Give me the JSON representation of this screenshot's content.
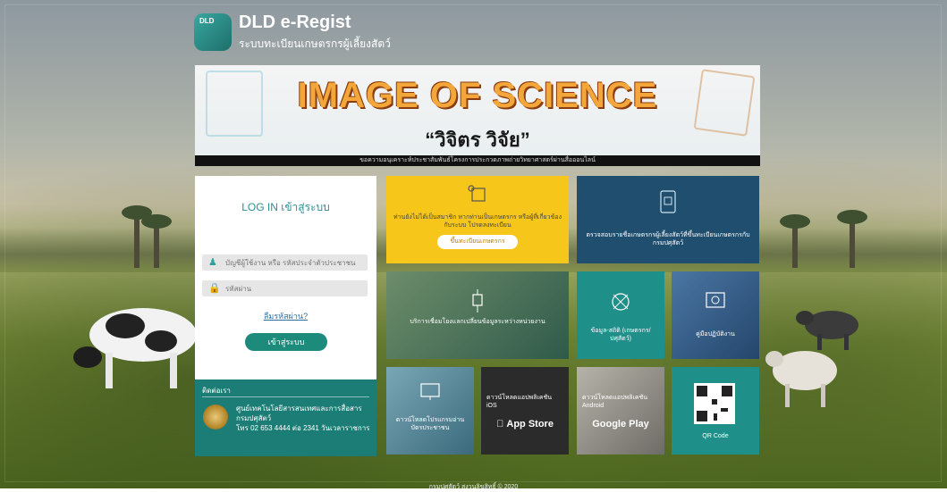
{
  "app": {
    "logo_text": "DLD",
    "title": "DLD e-Regist",
    "subtitle": "ระบบทะเบียนเกษตรกรผู้เลี้ยงสัตว์"
  },
  "banner": {
    "main": "IMAGE OF SCIENCE",
    "sub": "“วิจิตร วิจัย”",
    "caption": "ขอความอนุเคราะห์ประชาสัมพันธ์โครงการประกวดภาพถ่ายวิทยาศาสตร์ผ่านสื่อออนไลน์"
  },
  "login": {
    "title": "LOG IN เข้าสู่ระบบ",
    "username_placeholder": "บัญชีผู้ใช้งาน หรือ รหัสประจำตัวประชาชน",
    "password_placeholder": "รหัสผ่าน",
    "forgot": "ลืมรหัสผ่าน?",
    "submit": "เข้าสู่ระบบ"
  },
  "contact": {
    "heading": "ติดต่อเรา",
    "org": "ศูนย์เทคโนโลยีสารสนเทศและการสื่อสารกรมปศุสัตว์",
    "phone": "โทร 02 653 4444 ต่อ 2341 วันเวลาราชการ"
  },
  "tiles": {
    "register_text": "ท่านยังไม่ได้เป็นสมาชิก หากท่านเป็นเกษตรกร หรือผู้ที่เกี่ยวข้องกับระบบ โปรดลงทะเบียน",
    "register_button": "ขึ้นทะเบียนเกษตรกร",
    "check_text": "ตรวจสอบรายชื่อเกษตรกรผู้เลี้ยงสัตว์ที่ขึ้นทะเบียนเกษตรกรกับกรมปศุสัตว์",
    "link_text": "บริการเชื่อมโยงแลกเปลี่ยนข้อมูลระหว่างหน่วยงาน",
    "stats_text": "ข้อมูล-สถิติ (เกษตรกร/ปศุสัตว์)",
    "manual_text": "คู่มือปฏิบัติงาน",
    "apps_text": "ดาวน์โหลดโปรแกรมอ่านบัตรประชาชน",
    "ios_text": "ดาวน์โหลดแอปพลิเคชัน iOS",
    "ios_store": "App Store",
    "android_text": "ดาวน์โหลดแอปพลิเคชัน Android",
    "android_store": "Google Play",
    "qr_text": "QR Code"
  },
  "footer": "กรมปศุสัตว์ สงวนลิขสิทธิ์ © 2020"
}
